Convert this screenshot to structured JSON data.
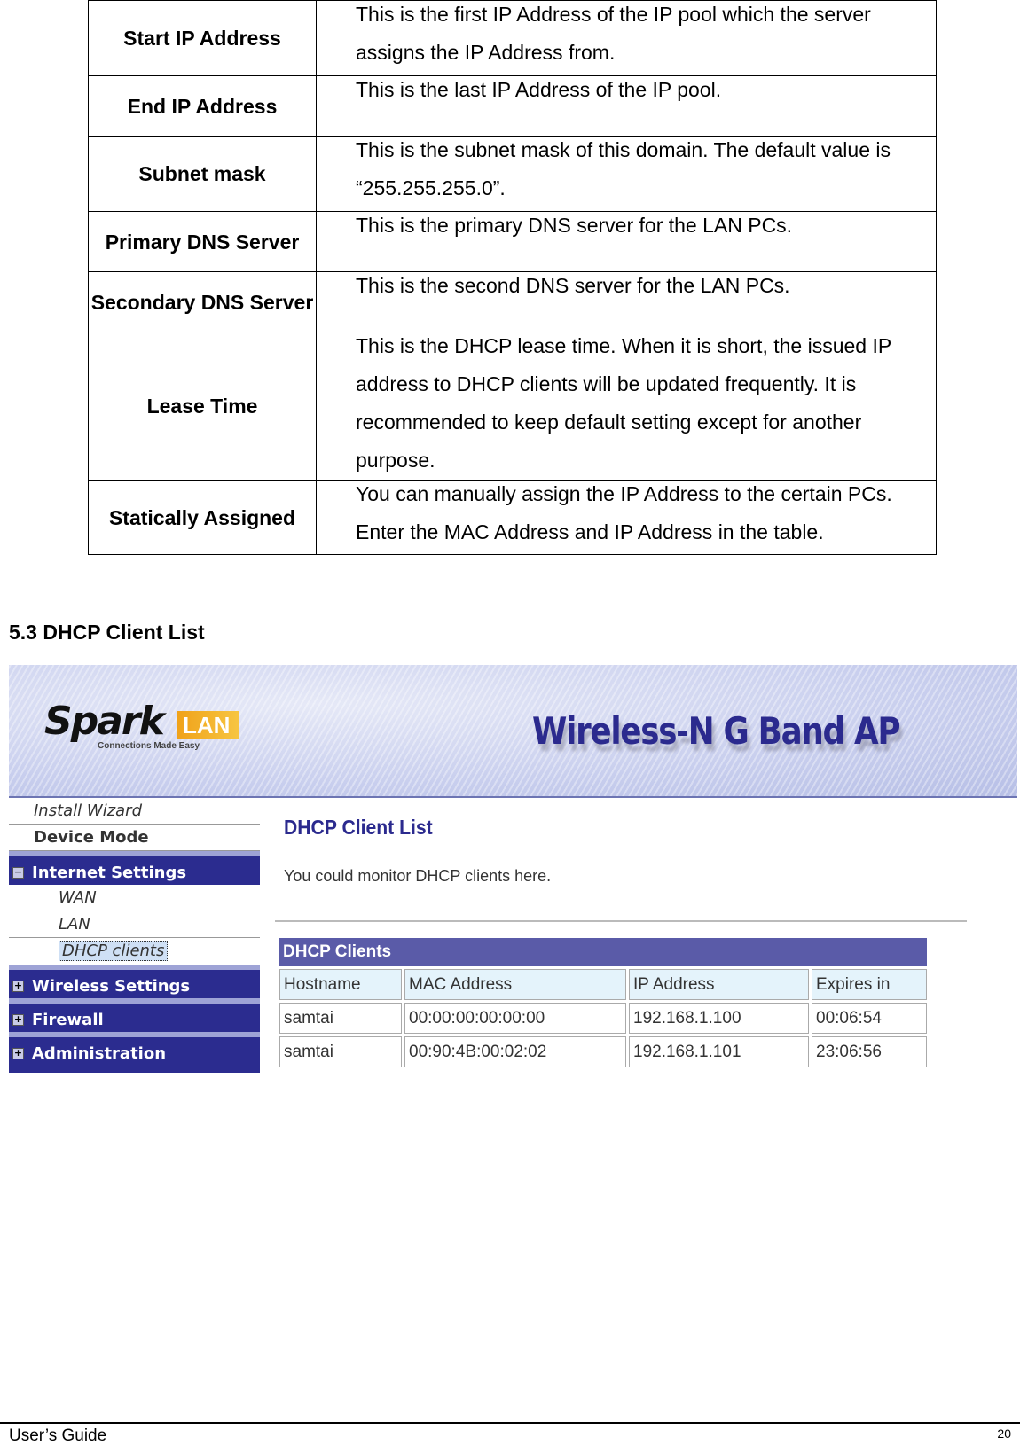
{
  "param_table": [
    {
      "label": "Start IP Address",
      "desc": "This is the first IP Address of the IP pool which the server assigns the IP Address from."
    },
    {
      "label": "End IP Address",
      "desc": "This is the last IP Address of the IP pool."
    },
    {
      "label": "Subnet mask",
      "desc": "This is the subnet mask of this domain. The default value is “255.255.255.0”."
    },
    {
      "label": "Primary DNS Server",
      "desc": "This is the primary DNS server for the LAN PCs."
    },
    {
      "label": "Secondary DNS Server",
      "desc": "This is the second DNS server for the LAN PCs."
    },
    {
      "label": "Lease Time",
      "desc": "This is the DHCP lease time. When it is short, the issued IP address to DHCP clients will be updated frequently. It is recommended to keep default setting except for another purpose."
    },
    {
      "label": "Statically Assigned",
      "desc": "You can manually assign the IP Address to the certain PCs. Enter the MAC Address and IP Address in the table."
    }
  ],
  "section_title": "5.3 DHCP Client List",
  "screenshot": {
    "logo": {
      "brand": "Spark",
      "brand_suffix": "LAN",
      "tagline": "Connections Made Easy"
    },
    "product_title": "Wireless-N G Band AP",
    "sidebar": {
      "install_wizard": "Install Wizard",
      "device_mode": "Device Mode",
      "internet_settings": "Internet Settings",
      "wan": "WAN",
      "lan": "LAN",
      "dhcp_clients": "DHCP clients",
      "wireless_settings": "Wireless Settings",
      "firewall": "Firewall",
      "administration": "Administration",
      "expanded_symbol": "−",
      "collapsed_symbol": "+"
    },
    "content": {
      "title": "DHCP Client List",
      "description": "You could monitor DHCP clients here.",
      "table_caption": "DHCP Clients",
      "columns": [
        "Hostname",
        "MAC Address",
        "IP Address",
        "Expires in"
      ],
      "rows": [
        [
          "samtai",
          "00:00:00:00:00:00",
          "192.168.1.100",
          "00:06:54"
        ],
        [
          "samtai",
          "00:90:4B:00:02:02",
          "192.168.1.101",
          "23:06:56"
        ]
      ]
    }
  },
  "footer": {
    "left": "User’s Guide",
    "page_number": "20"
  }
}
